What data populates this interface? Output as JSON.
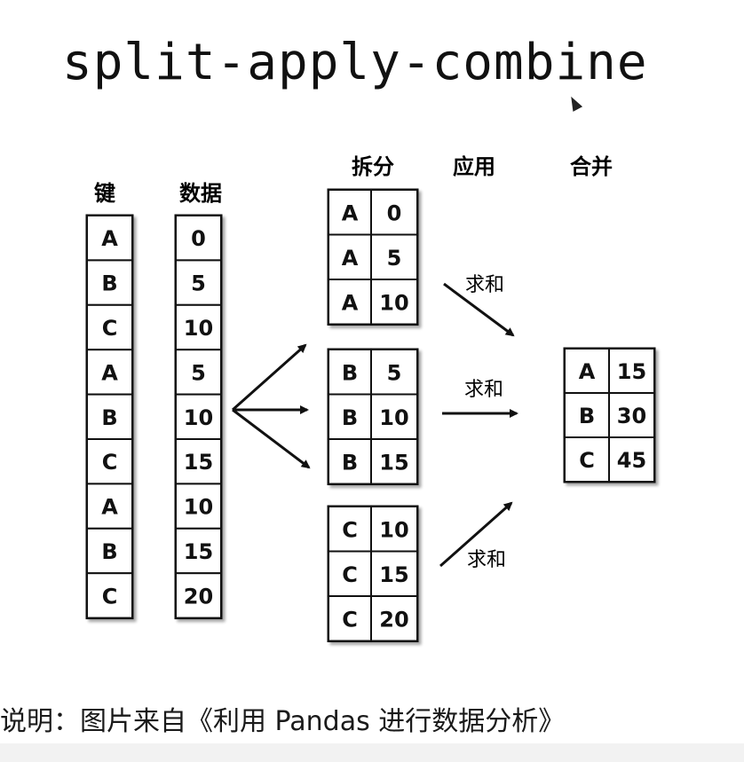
{
  "title": "split-apply-combine",
  "caption": "说明：图片来自《利用 Pandas 进行数据分析》",
  "headers": {
    "key": "键",
    "data": "数据",
    "split": "拆分",
    "apply": "应用",
    "combine": "合并"
  },
  "apply_label": "求和",
  "keys": [
    "A",
    "B",
    "C",
    "A",
    "B",
    "C",
    "A",
    "B",
    "C"
  ],
  "values": [
    "0",
    "5",
    "10",
    "5",
    "10",
    "15",
    "10",
    "15",
    "20"
  ],
  "groups": [
    {
      "rows": [
        [
          "A",
          "0"
        ],
        [
          "A",
          "5"
        ],
        [
          "A",
          "10"
        ]
      ]
    },
    {
      "rows": [
        [
          "B",
          "5"
        ],
        [
          "B",
          "10"
        ],
        [
          "B",
          "15"
        ]
      ]
    },
    {
      "rows": [
        [
          "C",
          "10"
        ],
        [
          "C",
          "15"
        ],
        [
          "C",
          "20"
        ]
      ]
    }
  ],
  "result": [
    [
      "A",
      "15"
    ],
    [
      "B",
      "30"
    ],
    [
      "C",
      "45"
    ]
  ]
}
